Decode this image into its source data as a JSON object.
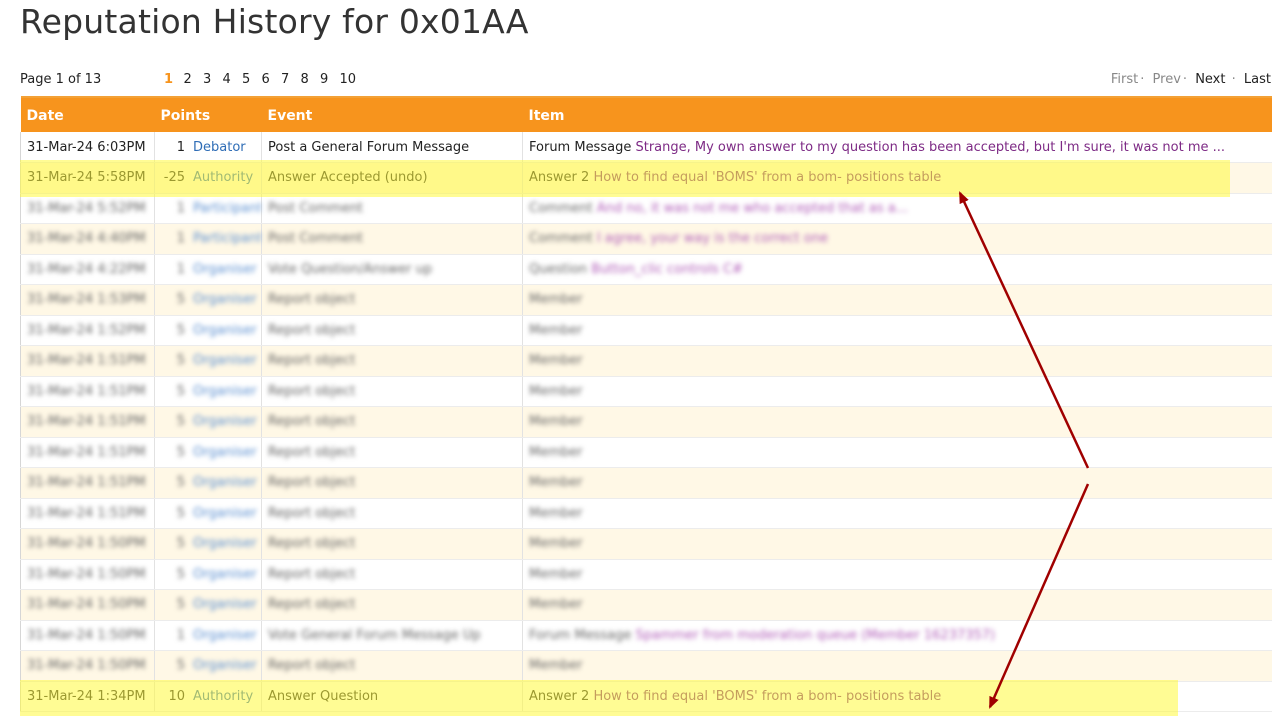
{
  "page": {
    "title": "Reputation History for 0x01AA"
  },
  "pager": {
    "info": "Page 1 of 13",
    "pages": [
      "1",
      "2",
      "3",
      "4",
      "5",
      "6",
      "7",
      "8",
      "9",
      "10"
    ],
    "first": "First",
    "prev": "Prev",
    "next": "Next",
    "last": "Last"
  },
  "table": {
    "headers": {
      "date": "Date",
      "points": "Points",
      "event": "Event",
      "item": "Item"
    },
    "rows": [
      {
        "date": "31-Mar-24 6:03PM",
        "points": "1",
        "badge": "Debator",
        "event": "Post a General Forum Message",
        "item_type": "Forum Message",
        "item_title": "Strange, My own answer to my question has been accepted, but I'm sure, it was not me ..."
      },
      {
        "date": "31-Mar-24 5:58PM",
        "points": "-25",
        "badge": "Authority",
        "event": "Answer Accepted (undo)",
        "item_type": "Answer 2",
        "item_title": "How to find equal 'BOMS' from a bom- positions table"
      },
      {
        "date": "31-Mar-24 5:52PM",
        "points": "1",
        "badge": "Participant",
        "event": "Post Comment",
        "item_type": "Comment",
        "item_title": "And no, it was not me who accepted that as a..."
      },
      {
        "date": "31-Mar-24 4:40PM",
        "points": "1",
        "badge": "Participant",
        "event": "Post Comment",
        "item_type": "Comment",
        "item_title": "I agree, your way is the correct one"
      },
      {
        "date": "31-Mar-24 4:22PM",
        "points": "1",
        "badge": "Organiser",
        "event": "Vote Question/Answer up",
        "item_type": "Question",
        "item_title": "Button_clic controls C#"
      },
      {
        "date": "31-Mar-24 1:53PM",
        "points": "5",
        "badge": "Organiser",
        "event": "Report object",
        "item_type": "Member",
        "item_title": ""
      },
      {
        "date": "31-Mar-24 1:52PM",
        "points": "5",
        "badge": "Organiser",
        "event": "Report object",
        "item_type": "Member",
        "item_title": ""
      },
      {
        "date": "31-Mar-24 1:51PM",
        "points": "5",
        "badge": "Organiser",
        "event": "Report object",
        "item_type": "Member",
        "item_title": ""
      },
      {
        "date": "31-Mar-24 1:51PM",
        "points": "5",
        "badge": "Organiser",
        "event": "Report object",
        "item_type": "Member",
        "item_title": ""
      },
      {
        "date": "31-Mar-24 1:51PM",
        "points": "5",
        "badge": "Organiser",
        "event": "Report object",
        "item_type": "Member",
        "item_title": ""
      },
      {
        "date": "31-Mar-24 1:51PM",
        "points": "5",
        "badge": "Organiser",
        "event": "Report object",
        "item_type": "Member",
        "item_title": ""
      },
      {
        "date": "31-Mar-24 1:51PM",
        "points": "5",
        "badge": "Organiser",
        "event": "Report object",
        "item_type": "Member",
        "item_title": ""
      },
      {
        "date": "31-Mar-24 1:51PM",
        "points": "5",
        "badge": "Organiser",
        "event": "Report object",
        "item_type": "Member",
        "item_title": ""
      },
      {
        "date": "31-Mar-24 1:50PM",
        "points": "5",
        "badge": "Organiser",
        "event": "Report object",
        "item_type": "Member",
        "item_title": ""
      },
      {
        "date": "31-Mar-24 1:50PM",
        "points": "5",
        "badge": "Organiser",
        "event": "Report object",
        "item_type": "Member",
        "item_title": ""
      },
      {
        "date": "31-Mar-24 1:50PM",
        "points": "5",
        "badge": "Organiser",
        "event": "Report object",
        "item_type": "Member",
        "item_title": ""
      },
      {
        "date": "31-Mar-24 1:50PM",
        "points": "1",
        "badge": "Organiser",
        "event": "Vote General Forum Message Up",
        "item_type": "Forum Message",
        "item_title": "Spammer from moderation queue (Member 16237357)"
      },
      {
        "date": "31-Mar-24 1:50PM",
        "points": "5",
        "badge": "Organiser",
        "event": "Report object",
        "item_type": "Member",
        "item_title": ""
      },
      {
        "date": "31-Mar-24 1:34PM",
        "points": "10",
        "badge": "Authority",
        "event": "Answer Question",
        "item_type": "Answer 2",
        "item_title": "How to find equal 'BOMS' from a bom- positions table"
      }
    ]
  },
  "colors": {
    "header_bg": "#f7941d",
    "highlight": "#fffa3c",
    "arrow": "#a00000",
    "badge_link": "#2f6db6",
    "item_link": "#7d2a85"
  }
}
